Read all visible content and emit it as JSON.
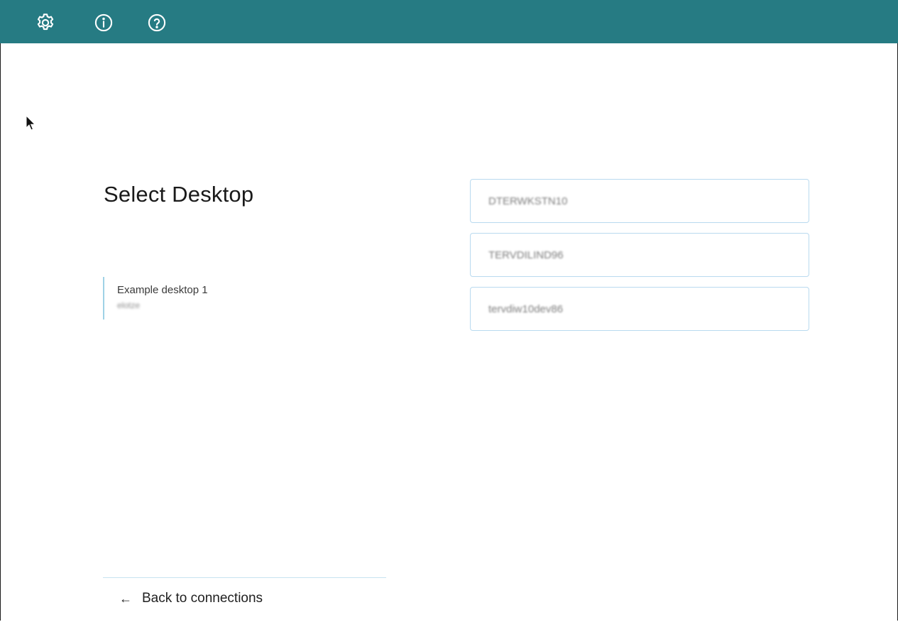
{
  "header": {
    "background_color": "#267b83",
    "icons": [
      "gear-icon",
      "info-icon",
      "help-icon"
    ]
  },
  "main": {
    "title": "Select Desktop",
    "desktop_item": {
      "name": "Example desktop 1",
      "user": "elotze"
    },
    "hosts": [
      {
        "label": "DTERWKSTN10"
      },
      {
        "label": "TERVDILIND96"
      },
      {
        "label": "tervdiw10dev86"
      }
    ],
    "back_label": "Back to connections",
    "back_icon": "arrow-left-icon"
  },
  "colors": {
    "accent": "#267b83",
    "border_light": "#b9daef",
    "item_border": "#9fd2e6"
  }
}
